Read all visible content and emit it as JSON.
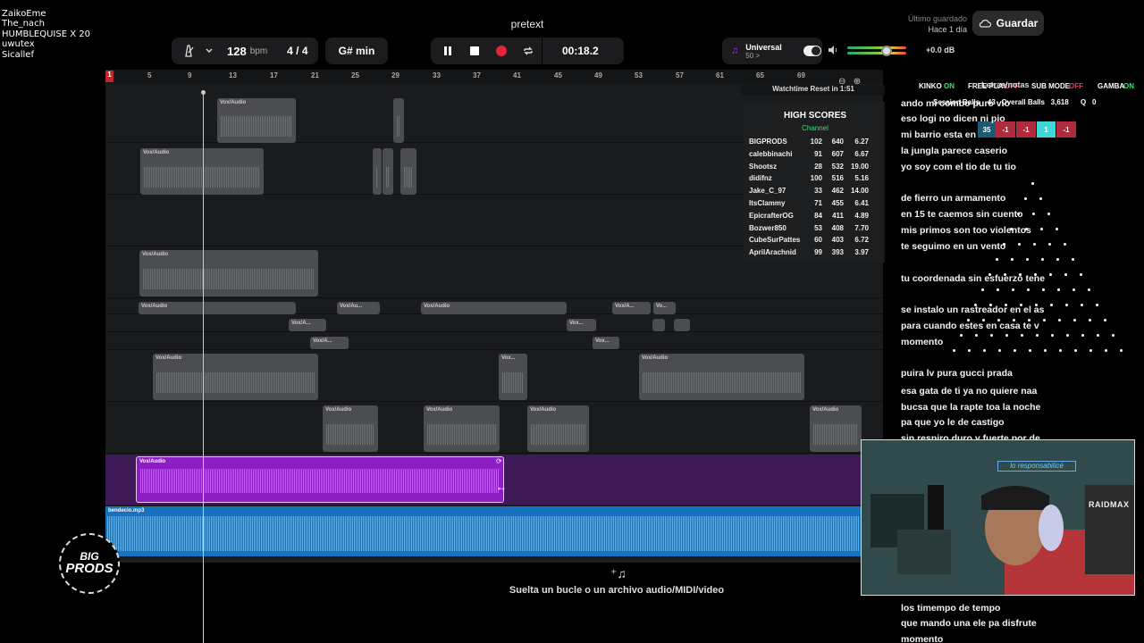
{
  "chat": {
    "names": [
      "ZaikoEme",
      "The_nach",
      "HUMBLEQUISE X 20",
      "uwutex",
      "Sicallef"
    ]
  },
  "app": {
    "project_title": "pretext",
    "last_saved_label": "Último guardado",
    "last_saved_time": "Hace 1 día",
    "save_button": "Guardar"
  },
  "toolbar": {
    "tempo_value": "128",
    "tempo_unit": "bpm",
    "time_signature": "4 / 4",
    "key": "G# min",
    "time_readout": "00:18.2",
    "universal_label": "Universal",
    "universal_sub": "50 >",
    "volume_db": "+0.0 dB",
    "volume_level": 0.62
  },
  "ruler": {
    "first": "1",
    "ticks": [
      "5",
      "9",
      "13",
      "17",
      "21",
      "25",
      "29",
      "33",
      "37",
      "41",
      "45",
      "49",
      "53",
      "57",
      "61",
      "65",
      "69"
    ]
  },
  "clips": {
    "vox_label": "Vox/Audio",
    "vox_short": "Vox/A...",
    "vox_short2": "Vox/Au...",
    "vox_short3": "Vo...",
    "vox_short4": "Vox...",
    "vox_short5": "Vox/..."
  },
  "blue_track": {
    "label": "bendecio.mp3"
  },
  "drop_zone": {
    "text": "Suelta un bucle o un archivo audio/MIDI/video"
  },
  "overlay": {
    "watch_reset": "Watchtime Reset in 1:51",
    "high_scores_title": "HIGH SCORES",
    "high_scores_channel": "Channel",
    "scores": [
      {
        "name": "BIGPRODS",
        "a": "102",
        "b": "640",
        "c": "6.27"
      },
      {
        "name": "calebbinachi",
        "a": "91",
        "b": "607",
        "c": "6.67"
      },
      {
        "name": "Shootsz",
        "a": "28",
        "b": "532",
        "c": "19.00"
      },
      {
        "name": "didifnz",
        "a": "100",
        "b": "516",
        "c": "5.16"
      },
      {
        "name": "Jake_C_97",
        "a": "33",
        "b": "462",
        "c": "14.00"
      },
      {
        "name": "ItsClammy",
        "a": "71",
        "b": "455",
        "c": "6.41"
      },
      {
        "name": "EpicrafterOG",
        "a": "84",
        "b": "411",
        "b2": "",
        "c": "4.89"
      },
      {
        "name": "Bozwer850",
        "a": "53",
        "b": "408",
        "c": "7.70"
      },
      {
        "name": "CubeSurPattes",
        "a": "60",
        "b": "403",
        "c": "6.72"
      },
      {
        "name": "AprilArachnid",
        "a": "99",
        "b": "393",
        "c": "3.97"
      }
    ],
    "status": {
      "kinko": "KINKO",
      "kinko_state": "ON",
      "freeplay": "FREE PLAY",
      "freeplay_state": "OFF",
      "submode": "SUB MODE",
      "submode_state": "OFF",
      "gamba": "GAMBA",
      "gamba_state": "ON"
    },
    "session": {
      "session_balls_label": "Session Balls",
      "session_balls": "43",
      "overall_balls_label": "Overall Balls",
      "overall_balls": "3,618",
      "q_label": "Q",
      "q_value": "0"
    },
    "chips": [
      "35",
      "-1",
      "-1",
      "1",
      "-1"
    ]
  },
  "lyrics": {
    "header": "Letras/notas",
    "lines": [
      "ando mi combo puro vio",
      "eso logi no dicen ni pio",
      "mi barrio esta en",
      "la jungla parece caserio",
      "yo soy com el tio de tu tio",
      "",
      "de fierro un armamento",
      "en 15 te  caemos sin cuento",
      "mis primos son too violentos",
      "te seguimo en un vento",
      "",
      "tu coordenada sin esfuerzo tene",
      "",
      "se instalo un rastreador en el as",
      "para cuando estes en casa te v",
      "momento",
      "",
      "puira lv pura gucci prada",
      "esa gata de ti ya no quiere naa",
      "bucsa que la rapte toa la noche",
      "pa que yo le de castigo",
      "sin respiro duro y fuerte  por de"
    ],
    "bottom_lines": [
      "los timempo de tempo",
      "que mando una ele pa   disfrute",
      "momento"
    ]
  },
  "webcam": {
    "sign": "lo responsabilicé",
    "brand": "RAIDMAX"
  },
  "logo": {
    "line1": "BIG",
    "line2": "PRODS"
  },
  "colors": {
    "accent_red": "#e0243a",
    "purple_clip": "#8d1ec4",
    "blue_track": "#1672be",
    "on_green": "#3ee07a",
    "off_red": "#e04060"
  }
}
